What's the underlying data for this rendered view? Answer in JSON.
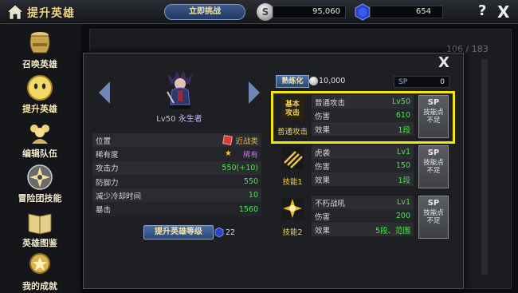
{
  "header": {
    "title": "提升英雄",
    "action_button": "立即挑战",
    "silver_icon_text": "S",
    "silver_amount": "95,060",
    "gem_amount": "654",
    "help": "?",
    "close": "X"
  },
  "sidebar": {
    "items": [
      {
        "label": "召唤英雄",
        "icon": "summon-jar-icon"
      },
      {
        "label": "提升英雄",
        "icon": "hero-face-icon",
        "active": true
      },
      {
        "label": "编辑队伍",
        "icon": "team-icon"
      },
      {
        "label": "冒险团技能",
        "icon": "shuriken-icon"
      },
      {
        "label": "英雄图鉴",
        "icon": "book-icon"
      },
      {
        "label": "我的成就",
        "icon": "medal-icon"
      }
    ]
  },
  "background": {
    "count": "106 / 183"
  },
  "modal": {
    "close": "X",
    "hero": {
      "name": "Lv50 永生者"
    },
    "stats": [
      {
        "label": "位置",
        "value": "近战类"
      },
      {
        "label": "稀有度",
        "value": "稀有"
      },
      {
        "label": "攻击力",
        "value": "550(+10)"
      },
      {
        "label": "防御力",
        "value": "550"
      },
      {
        "label": "减少冷却时间",
        "value": "10"
      },
      {
        "label": "暴击",
        "value": "1560"
      }
    ],
    "upgrade_button": "提升英雄等级",
    "upgrade_cost": "22",
    "proficiency_button": "熟练化",
    "proficiency_cost": "10,000",
    "sp_label": "SP",
    "sp_value": "0",
    "skills": [
      {
        "label": "普通攻击",
        "icon_text": "基本\n攻击",
        "rows": [
          {
            "k": "普通攻击",
            "v": "Lv50"
          },
          {
            "k": "伤害",
            "v": "610"
          },
          {
            "k": "效果",
            "v": "1段"
          }
        ],
        "sp_button": {
          "top": "SP",
          "line1": "技能点",
          "line2": "不足"
        }
      },
      {
        "label": "技能1",
        "rows": [
          {
            "k": "虎袭",
            "v": "Lv1"
          },
          {
            "k": "伤害",
            "v": "150"
          },
          {
            "k": "效果",
            "v": "1段"
          }
        ],
        "sp_button": {
          "top": "SP",
          "line1": "技能点",
          "line2": "不足"
        }
      },
      {
        "label": "技能2",
        "rows": [
          {
            "k": "不朽战吼",
            "v": "Lv1"
          },
          {
            "k": "伤害",
            "v": "200"
          },
          {
            "k": "效果",
            "v": "5段、范围"
          }
        ],
        "sp_button": {
          "top": "SP",
          "line1": "技能点",
          "line2": "不足"
        }
      }
    ]
  },
  "colors": {
    "highlight": "#f5e60a",
    "stat_value": "#4fe34f",
    "rarity": "#c46ef0",
    "skill_label": "#f1d54a"
  }
}
